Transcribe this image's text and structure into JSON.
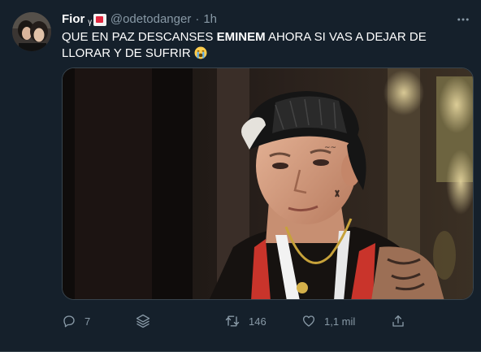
{
  "tweet": {
    "display_name": "Fior",
    "name_emoji": "ᵧ",
    "handle": "@odetodanger",
    "separator": "·",
    "time": "1h",
    "text_before": "QUE EN PAZ DESCANSES ",
    "text_bold": "EMINEM",
    "text_after": " AHORA SI VAS A DEJAR DE LLORAR Y DE SUFRIR"
  },
  "actions": {
    "reply_count": "7",
    "retweet_count": "146",
    "like_count": "1,1 mil"
  },
  "icons": {
    "more": "more-horizontal-icon",
    "reply": "reply-icon",
    "stack": "layers-icon",
    "retweet": "retweet-icon",
    "like": "heart-icon",
    "share": "share-icon"
  },
  "colors": {
    "background": "#15202b",
    "secondary_text": "#8899a6",
    "divider": "#38444d"
  }
}
